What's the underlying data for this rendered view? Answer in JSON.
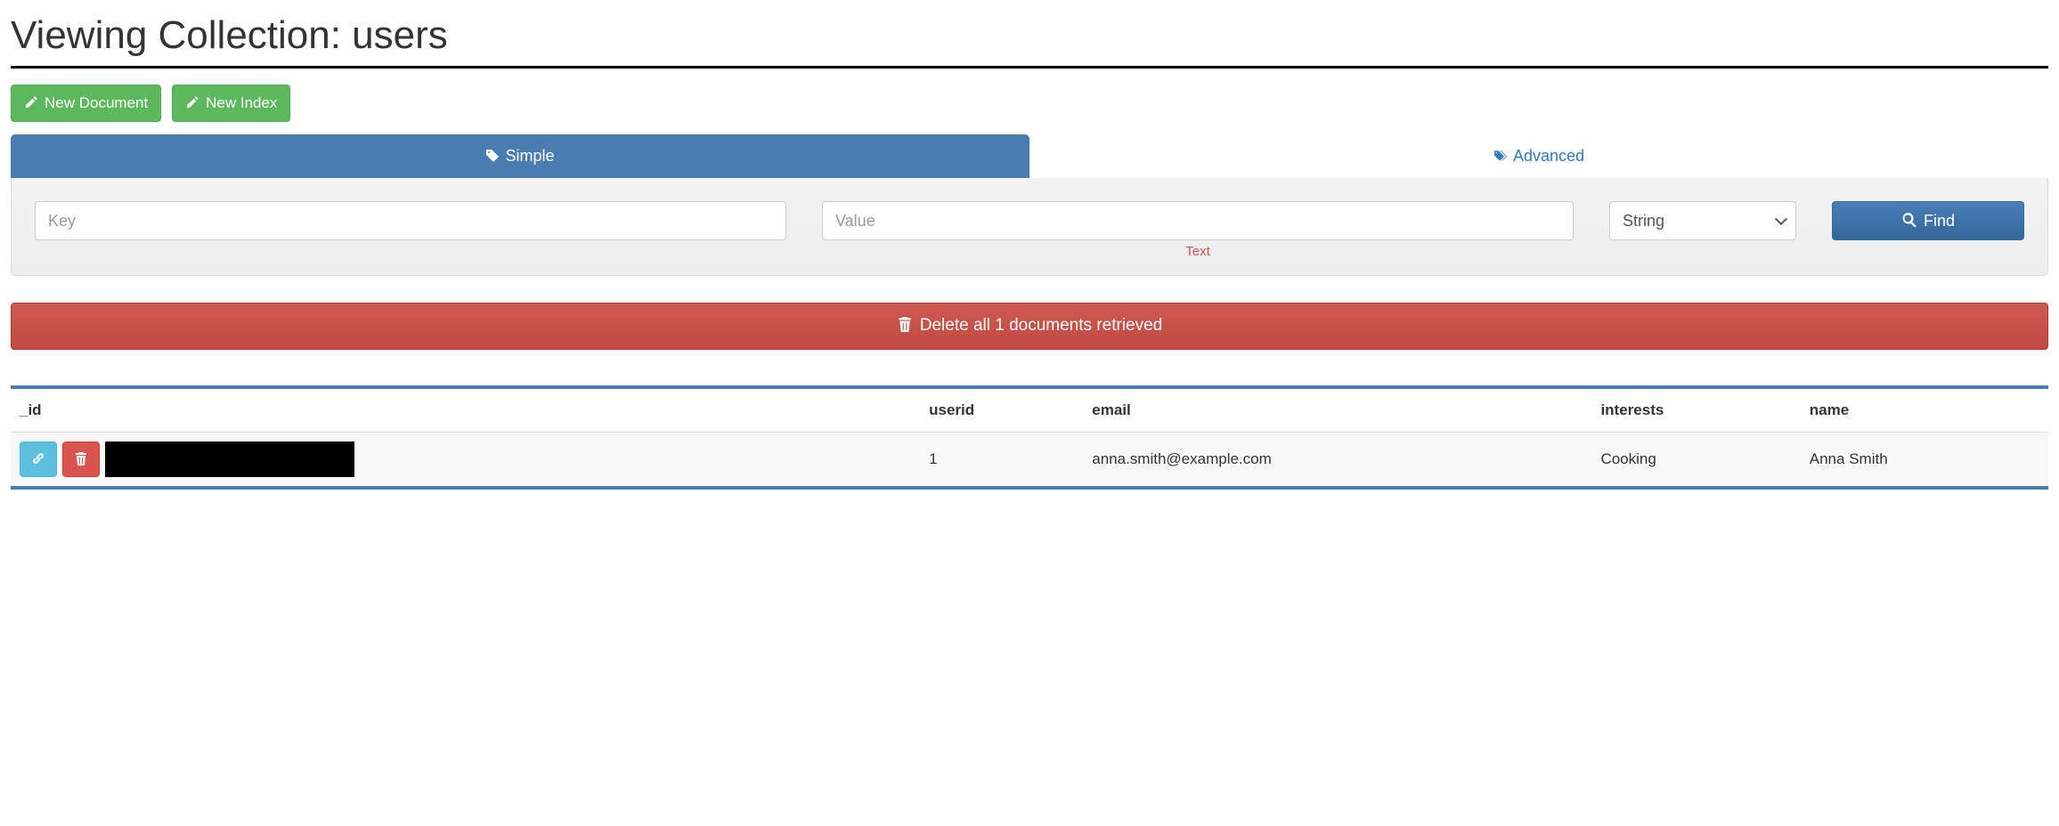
{
  "page": {
    "title": "Viewing Collection: users"
  },
  "toolbar": {
    "new_document_label": "New Document",
    "new_index_label": "New Index"
  },
  "tabs": {
    "simple_label": "Simple",
    "advanced_label": "Advanced"
  },
  "search": {
    "key_placeholder": "Key",
    "value_placeholder": "Value",
    "value_helper": "Text",
    "type_options": [
      "String"
    ],
    "type_selected": "String",
    "find_label": "Find"
  },
  "delete_bar": {
    "label": "Delete all 1 documents retrieved"
  },
  "table": {
    "columns": [
      "_id",
      "userid",
      "email",
      "interests",
      "name"
    ],
    "rows": [
      {
        "id_redacted": true,
        "userid": "1",
        "email": "anna.smith@example.com",
        "interests": "Cooking",
        "name": "Anna Smith"
      }
    ]
  }
}
